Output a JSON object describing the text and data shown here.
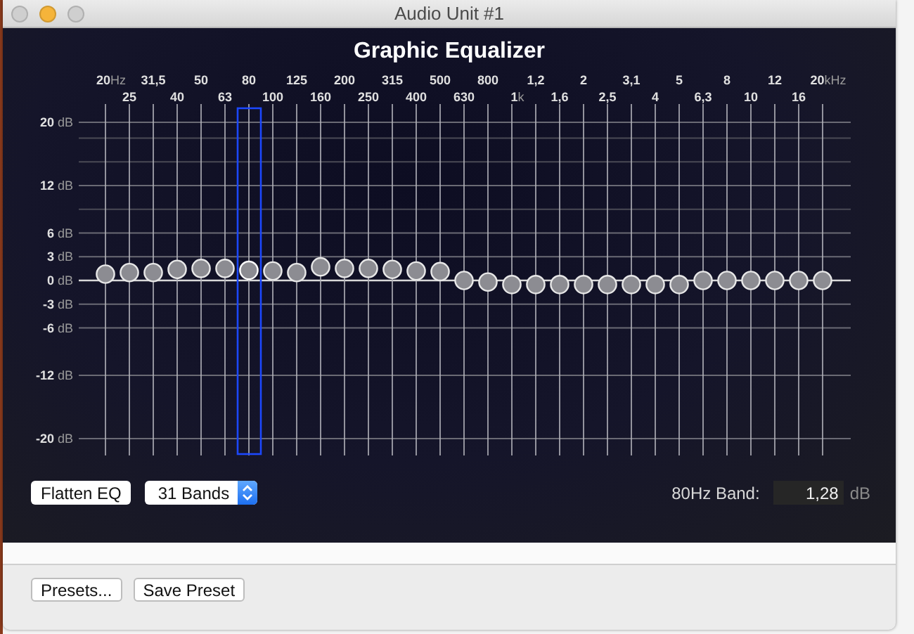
{
  "window": {
    "title": "Audio Unit #1",
    "buttons": [
      {
        "color": "#cfcfcf"
      },
      {
        "color": "#f5b43a"
      },
      {
        "color": "#cfcfcf"
      }
    ]
  },
  "equalizer": {
    "title": "Graphic Equalizer",
    "gain_axis": [
      {
        "value": "20",
        "unit": "dB"
      },
      {
        "value": "12",
        "unit": "dB"
      },
      {
        "value": "6",
        "unit": "dB"
      },
      {
        "value": "3",
        "unit": "dB"
      },
      {
        "value": "0",
        "unit": "dB"
      },
      {
        "value": "-3",
        "unit": "dB"
      },
      {
        "value": "-6",
        "unit": "dB"
      },
      {
        "value": "-12",
        "unit": "dB"
      },
      {
        "value": "-20",
        "unit": "dB"
      }
    ],
    "bands": [
      {
        "label": "20",
        "unit": "Hz",
        "level": 0.52,
        "selected": false
      },
      {
        "label": "25",
        "level": 0.525,
        "selected": false
      },
      {
        "label": "31,5",
        "level": 0.525,
        "selected": false
      },
      {
        "label": "40",
        "level": 0.535,
        "selected": false
      },
      {
        "label": "50",
        "level": 0.538,
        "selected": false
      },
      {
        "label": "63",
        "level": 0.538,
        "selected": false
      },
      {
        "label": "80",
        "level": 0.532,
        "selected": true
      },
      {
        "label": "100",
        "level": 0.53,
        "selected": false
      },
      {
        "label": "125",
        "level": 0.525,
        "selected": false
      },
      {
        "label": "160",
        "level": 0.543,
        "selected": false
      },
      {
        "label": "200",
        "level": 0.538,
        "selected": false
      },
      {
        "label": "250",
        "level": 0.538,
        "selected": false
      },
      {
        "label": "315",
        "level": 0.535,
        "selected": false
      },
      {
        "label": "400",
        "level": 0.53,
        "selected": false
      },
      {
        "label": "500",
        "level": 0.528,
        "selected": false
      },
      {
        "label": "630",
        "level": 0.5,
        "selected": false
      },
      {
        "label": "800",
        "level": 0.495,
        "selected": false
      },
      {
        "label": "1",
        "unit": "k",
        "level": 0.487,
        "selected": false
      },
      {
        "label": "1,2",
        "level": 0.487,
        "selected": false
      },
      {
        "label": "1,6",
        "level": 0.487,
        "selected": false
      },
      {
        "label": "2",
        "level": 0.487,
        "selected": false
      },
      {
        "label": "2,5",
        "level": 0.487,
        "selected": false
      },
      {
        "label": "3,1",
        "level": 0.487,
        "selected": false
      },
      {
        "label": "4",
        "level": 0.487,
        "selected": false
      },
      {
        "label": "5",
        "level": 0.487,
        "selected": false
      },
      {
        "label": "6,3",
        "level": 0.5,
        "selected": false
      },
      {
        "label": "8",
        "level": 0.5,
        "selected": false
      },
      {
        "label": "10",
        "level": 0.5,
        "selected": false
      },
      {
        "label": "12",
        "level": 0.5,
        "selected": false
      },
      {
        "label": "16",
        "level": 0.5,
        "selected": false
      },
      {
        "label": "20",
        "unit": "kHz",
        "level": 0.5,
        "selected": false
      }
    ],
    "flatten_button": "Flatten EQ",
    "bands_select": "31 Bands",
    "band_readout": {
      "label": "80Hz Band:",
      "value": "1,28",
      "unit": "dB"
    }
  },
  "footer_buttons": [
    "Presets...",
    "Save Preset"
  ]
}
